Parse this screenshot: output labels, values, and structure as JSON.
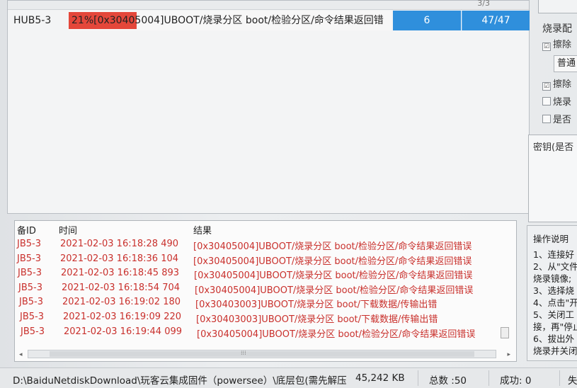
{
  "device_row": {
    "name": "HUB5-3",
    "progress_percent": 21,
    "progress_label": "21%",
    "message": "[0x30405004]UBOOT/烧录分区 boot/检验分区/命令结果返回错",
    "count": "6",
    "ratio": "47/47",
    "top_partial": "3/3"
  },
  "right_panel": {
    "burn_config": "烧录配",
    "erase1": "擦除",
    "select_value": "普通",
    "erase2": "擦除",
    "burn_chk": "烧录",
    "whether_chk": "是否",
    "key_label": "密钥(是否",
    "help_title": "操作说明",
    "help_lines": [
      "1、连接好",
      "2、从\"文件",
      "烧录镜像;",
      "3、选择烧",
      "4、点击\"开",
      "5、关闭工",
      "接，再\"停止",
      "6、拔出外",
      "烧录并关闭"
    ]
  },
  "log": {
    "headers": {
      "id": "备ID",
      "time": "时间",
      "result": "结果"
    },
    "rows": [
      {
        "id": "JB5-3",
        "time": "2021-02-03 16:18:28 490",
        "result": "[0x30405004]UBOOT/烧录分区 boot/检验分区/命令结果返回错误"
      },
      {
        "id": "JB5-3",
        "time": "2021-02-03 16:18:36 104",
        "result": "[0x30405004]UBOOT/烧录分区 boot/检验分区/命令结果返回错误"
      },
      {
        "id": "JB5-3",
        "time": "2021-02-03 16:18:45 893",
        "result": "[0x30405004]UBOOT/烧录分区 boot/检验分区/命令结果返回错误"
      },
      {
        "id": "JB5-3",
        "time": "2021-02-03 16:18:54 704",
        "result": "[0x30405004]UBOOT/烧录分区 boot/检验分区/命令结果返回错误"
      },
      {
        "id": "JB5-3",
        "time": "2021-02-03 16:19:02 180",
        "result": "[0x30403003]UBOOT/烧录分区 boot/下载数据/传输出错"
      },
      {
        "id": "JB5-3",
        "time": "2021-02-03 16:19:09 220",
        "result": "[0x30403003]UBOOT/烧录分区 boot/下载数据/传输出错"
      },
      {
        "id": "JB5-3",
        "time": "2021-02-03 16:19:44 099",
        "result": "[0x30405004]UBOOT/烧录分区 boot/检验分区/命令结果返回错误"
      }
    ]
  },
  "status_bar": {
    "path": "D:\\BaiduNetdiskDownload\\玩客云集成固件（powersee）\\底层包(需先解压",
    "size": "45,242 KB",
    "total": "总数 :50",
    "success": "成功:  0",
    "fail_partial": "失"
  }
}
